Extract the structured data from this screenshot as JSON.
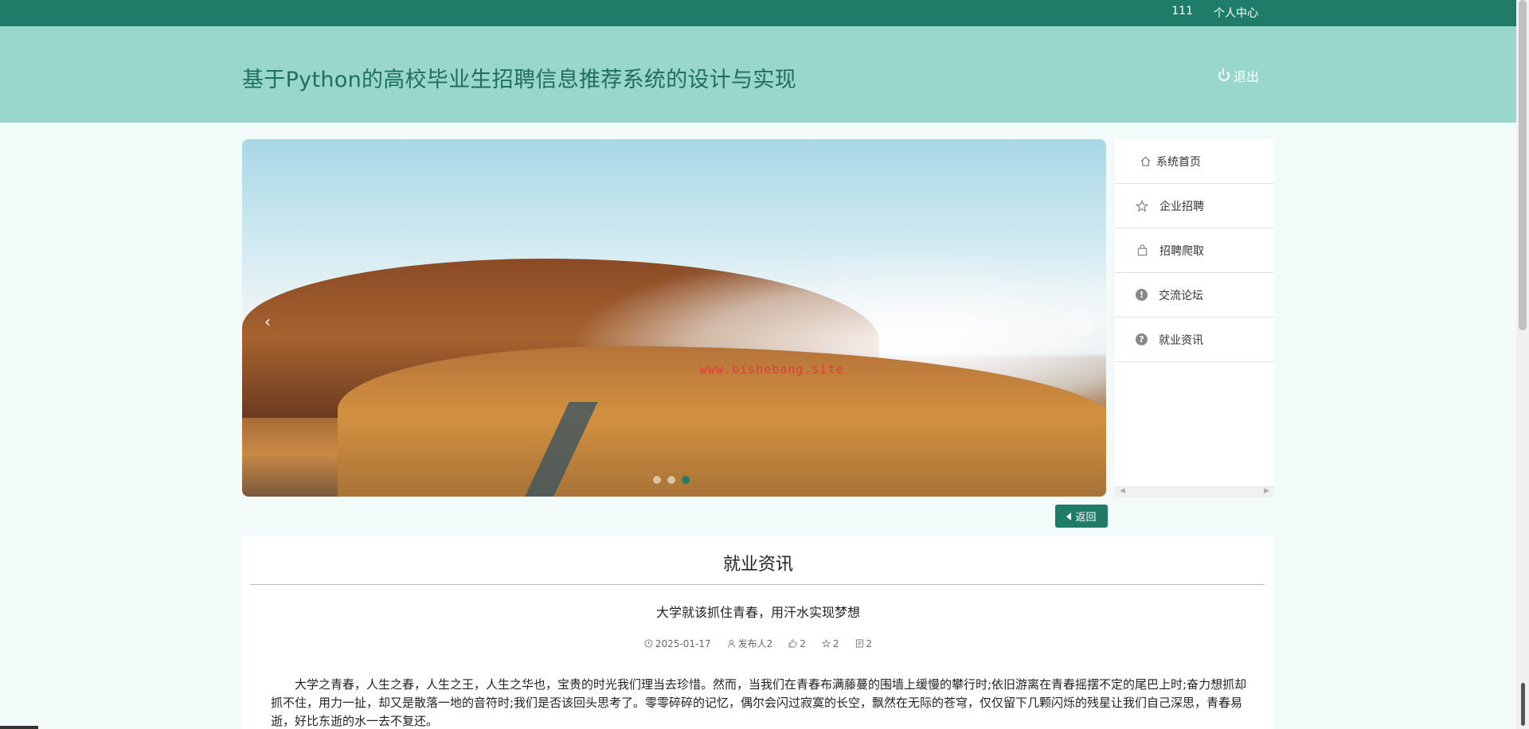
{
  "topbar": {
    "user": "111",
    "center_label": "个人中心"
  },
  "header": {
    "title": "基于Python的高校毕业生招聘信息推荐系统的设计与实现",
    "logout_label": "退出"
  },
  "carousel": {
    "watermark": "www.bishebang.site",
    "prev": "‹",
    "next": "›",
    "slide_count": 3,
    "active_index": 2
  },
  "menu": {
    "items": [
      {
        "label": "系统首页",
        "icon": "home-icon"
      },
      {
        "label": "企业招聘",
        "icon": "star-icon"
      },
      {
        "label": "招聘爬取",
        "icon": "bag-icon"
      },
      {
        "label": "交流论坛",
        "icon": "exclamation-circle-icon"
      },
      {
        "label": "就业资讯",
        "icon": "question-circle-icon"
      }
    ]
  },
  "back_label": "返回",
  "article": {
    "section": "就业资讯",
    "title": "大学就该抓住青春，用汗水实现梦想",
    "date": "2025-01-17",
    "author": "发布人2",
    "likes": "2",
    "favorites": "2",
    "comments": "2",
    "body": "大学之青春，人生之春，人生之王，人生之华也，宝贵的时光我们理当去珍惜。然而，当我们在青春布满藤蔓的围墙上缓慢的攀行时;依旧游离在青春摇摆不定的尾巴上时;奋力想抓却抓不住，用力一扯，却又是散落一地的音符时;我们是否该回头思考了。零零碎碎的记忆，偶尔会闪过寂寞的长空，飘然在无际的苍穹，仅仅留下几颗闪烁的残星让我们自己深思，青春易逝，好比东逝的水一去不复还。"
  },
  "colors": {
    "primary": "#1f7c69",
    "header_band": "#99d6cc"
  }
}
